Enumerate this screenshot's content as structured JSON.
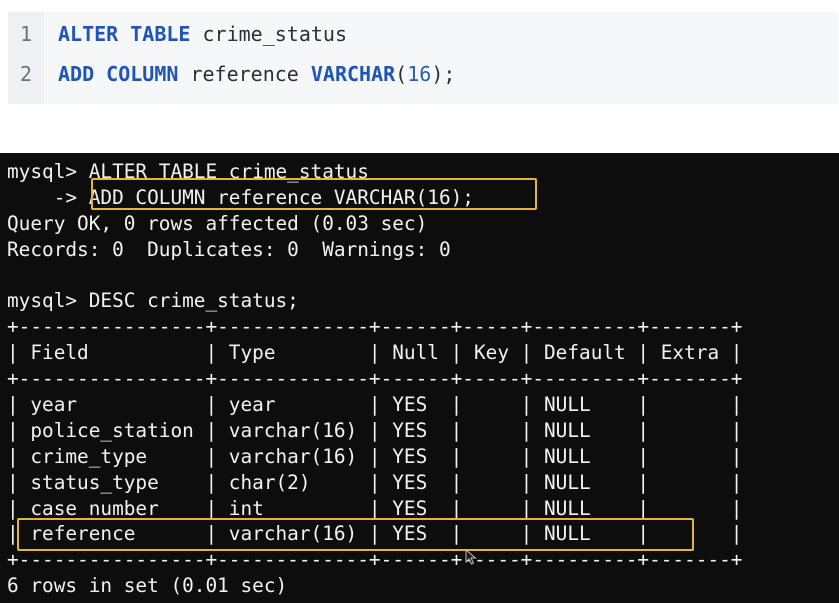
{
  "editor": {
    "lines": [
      {
        "number": "1",
        "kw1": "ALTER TABLE",
        "rest1": " crime_status"
      },
      {
        "number": "2",
        "kw1": "ADD COLUMN",
        "rest1": " reference ",
        "kw2": "VARCHAR",
        "p_open": "(",
        "num": "16",
        "p_close": ");"
      }
    ]
  },
  "terminal": {
    "lines": [
      "mysql> ALTER TABLE crime_status",
      "    -> ADD COLUMN reference VARCHAR(16);",
      "Query OK, 0 rows affected (0.03 sec)",
      "Records: 0  Duplicates: 0  Warnings: 0",
      "",
      "mysql> DESC crime_status;",
      "+----------------+-------------+------+-----+---------+-------+",
      "| Field          | Type        | Null | Key | Default | Extra |",
      "+----------------+-------------+------+-----+---------+-------+",
      "| year           | year        | YES  |     | NULL    |       |",
      "| police_station | varchar(16) | YES  |     | NULL    |       |",
      "| crime_type     | varchar(16) | YES  |     | NULL    |       |",
      "| status_type    | char(2)     | YES  |     | NULL    |       |",
      "| case_number    | int         | YES  |     | NULL    |       |",
      "| reference      | varchar(16) | YES  |     | NULL    |       |",
      "+----------------+-------------+------+-----+---------+-------+",
      "6 rows in set (0.01 sec)"
    ]
  },
  "colors": {
    "highlight": "#e3b53a",
    "keyword": "#1f55b8",
    "terminal_bg": "#0d0d0d"
  },
  "icons": {
    "cursor": "mouse-pointer-icon"
  }
}
